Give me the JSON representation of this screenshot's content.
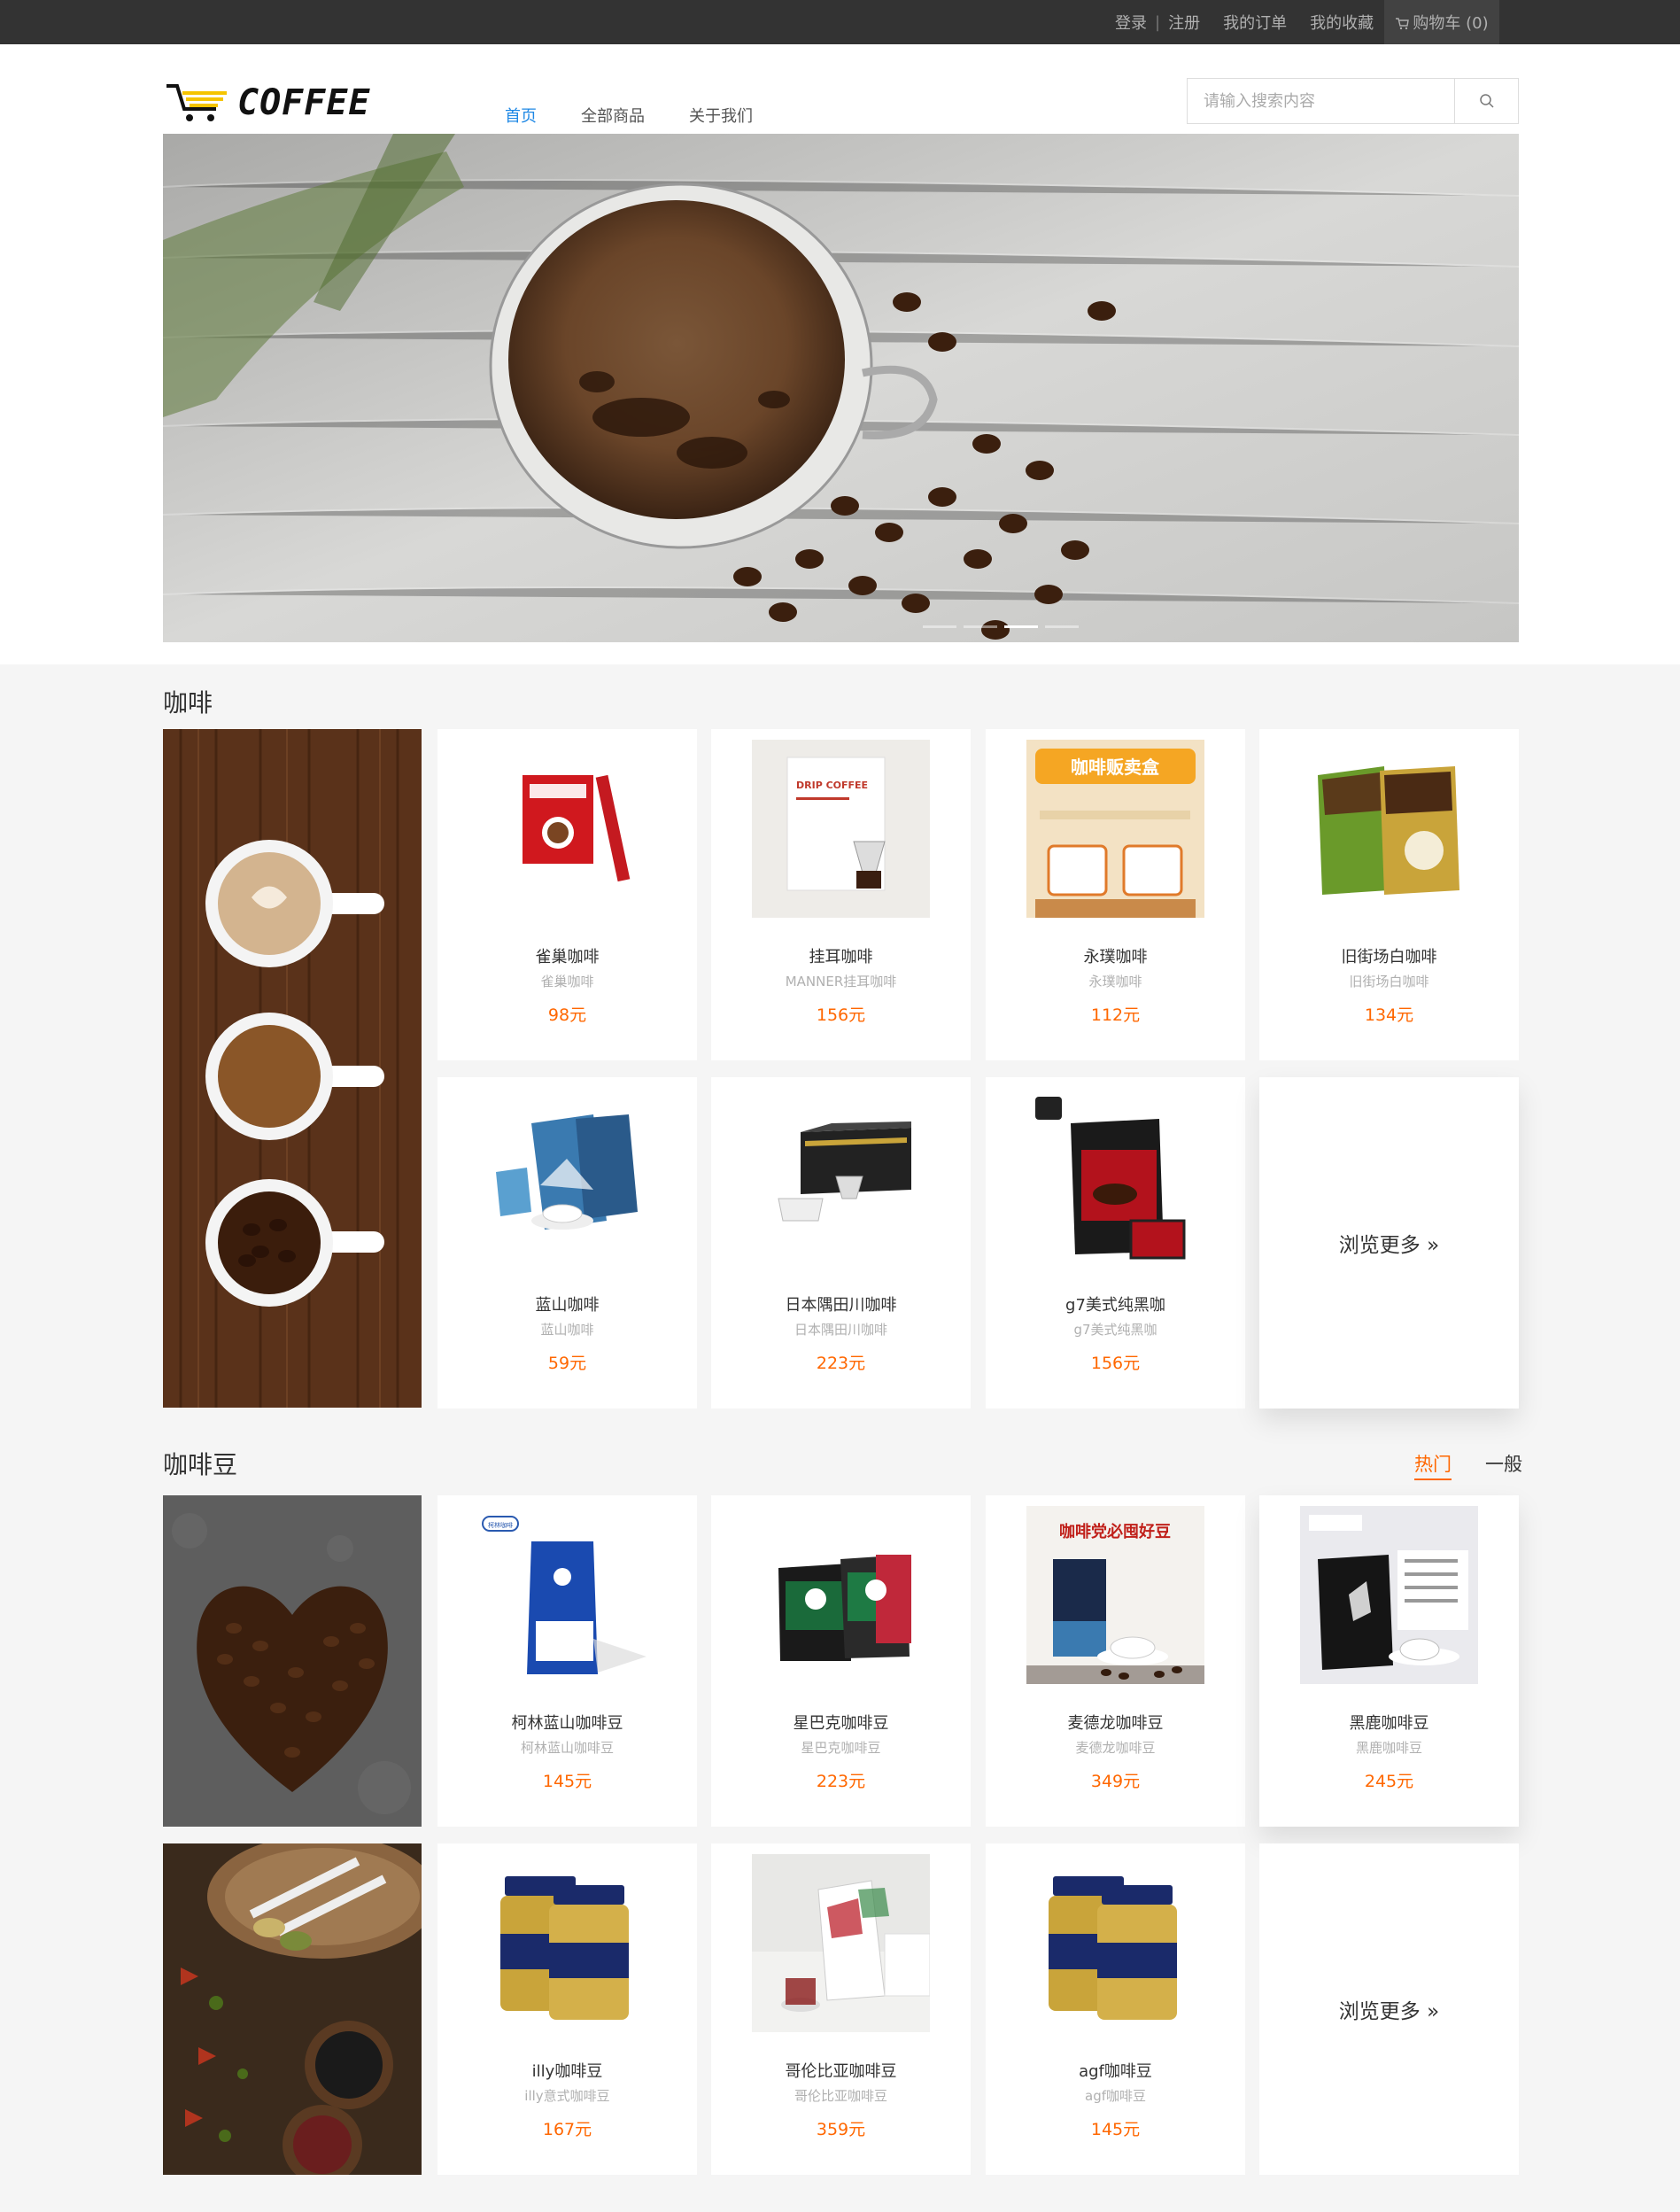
{
  "topbar": {
    "login": "登录",
    "divider": "|",
    "register": "注册",
    "orders": "我的订单",
    "favorites": "我的收藏",
    "cart": "购物车 (0)"
  },
  "header": {
    "logo_text": "COFFEE",
    "nav": [
      "首页",
      "全部商品",
      "关于我们"
    ],
    "search_placeholder": "请输入搜索内容"
  },
  "coffee_section": {
    "title": "咖啡",
    "more_label": "浏览更多 »",
    "products": [
      {
        "name": "雀巢咖啡",
        "desc": "雀巢咖啡",
        "price": "98元"
      },
      {
        "name": "挂耳咖啡",
        "desc": "MANNER挂耳咖啡",
        "price": "156元"
      },
      {
        "name": "永璞咖啡",
        "desc": "永璞咖啡",
        "price": "112元"
      },
      {
        "name": "旧街场白咖啡",
        "desc": "旧街场白咖啡",
        "price": "134元"
      },
      {
        "name": "蓝山咖啡",
        "desc": "蓝山咖啡",
        "price": "59元"
      },
      {
        "name": "日本隅田川咖啡",
        "desc": "日本隅田川咖啡",
        "price": "223元"
      },
      {
        "name": "g7美式纯黑咖",
        "desc": "g7美式纯黑咖",
        "price": "156元"
      }
    ]
  },
  "beans_section": {
    "title": "咖啡豆",
    "tabs": [
      "热门",
      "一般"
    ],
    "more_label": "浏览更多 »",
    "products": [
      {
        "name": "柯林蓝山咖啡豆",
        "desc": "柯林蓝山咖啡豆",
        "price": "145元"
      },
      {
        "name": "星巴克咖啡豆",
        "desc": "星巴克咖啡豆",
        "price": "223元"
      },
      {
        "name": "麦德龙咖啡豆",
        "desc": "麦德龙咖啡豆",
        "price": "349元"
      },
      {
        "name": "黑鹿咖啡豆",
        "desc": "黑鹿咖啡豆",
        "price": "245元"
      },
      {
        "name": "illy咖啡豆",
        "desc": "illy意式咖啡豆",
        "price": "167元"
      },
      {
        "name": "哥伦比亚咖啡豆",
        "desc": "哥伦比亚咖啡豆",
        "price": "359元"
      },
      {
        "name": "agf咖啡豆",
        "desc": "agf咖啡豆",
        "price": "145元"
      }
    ]
  },
  "product_images": {
    "drip_coffee": "DRIP COFFEE",
    "yongpu_banner": "咖啡贩卖盒",
    "colin_badge": "柯林咖啡",
    "metro_headline": "咖啡党必囤好豆"
  },
  "colors": {
    "accent": "#ff6700",
    "nav_active": "#1e88e5",
    "topbar": "#333333"
  }
}
